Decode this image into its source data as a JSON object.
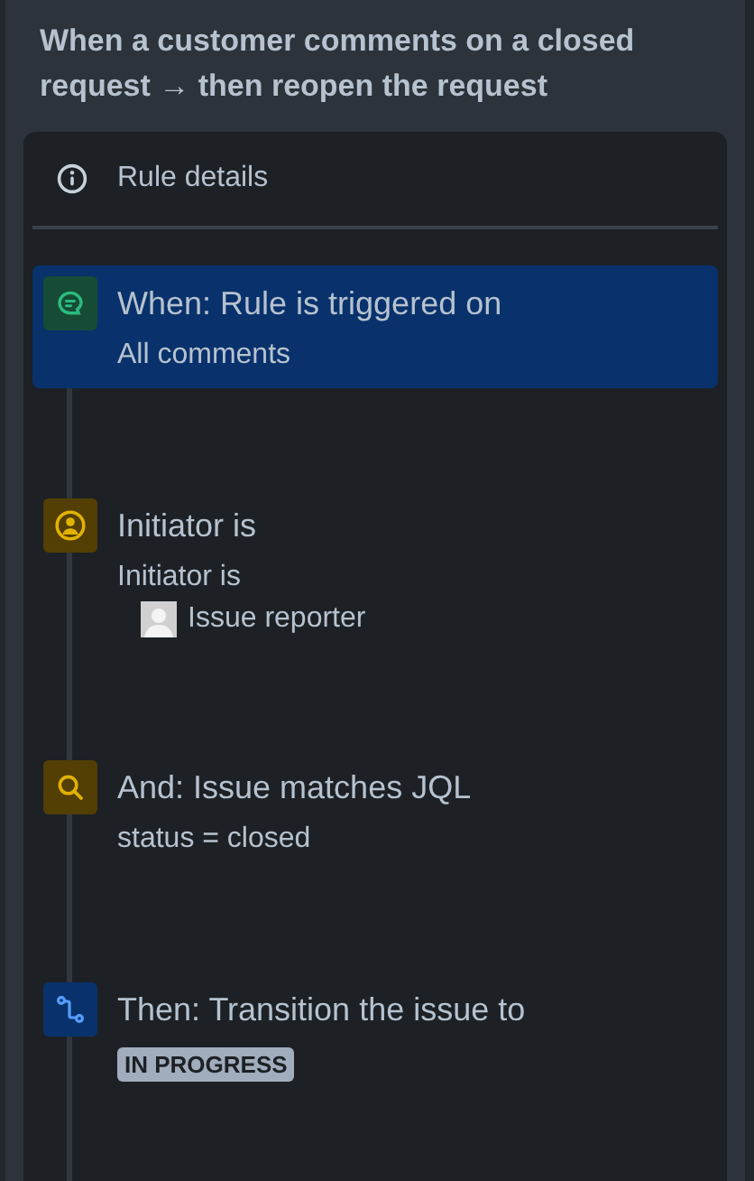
{
  "title": "When a customer comments on a closed request → then reopen the request",
  "details_label": "Rule details",
  "steps": [
    {
      "kind": "trigger",
      "title": "When: Rule is triggered on",
      "selected": true,
      "detail": "All comments"
    },
    {
      "kind": "user-condition",
      "title": "Initiator is",
      "selected": false,
      "detail": "Initiator is",
      "user": "Issue reporter"
    },
    {
      "kind": "jql-condition",
      "title": "And: Issue matches JQL",
      "selected": false,
      "detail": "status = closed"
    },
    {
      "kind": "action",
      "title": "Then: Transition the issue to",
      "selected": false,
      "status": "IN PROGRESS"
    }
  ]
}
